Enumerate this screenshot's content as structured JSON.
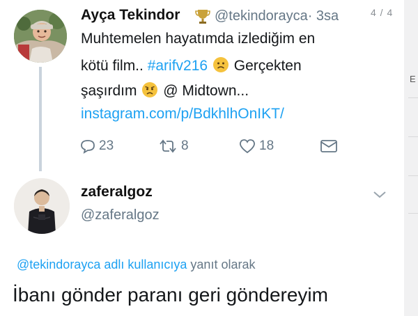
{
  "page_counter": "4 / 4",
  "tweet": {
    "author_name": "Ayça Tekindor",
    "author_handle": "@tekindorayca",
    "time": "· 3sa",
    "line1": "Muhtemelen hayatımda izlediğim en",
    "line2_text": "kötü film..",
    "hashtag": "#arifv216",
    "line2_after": "Gerçekten",
    "line3_before": "şaşırdım",
    "line3_after": "@ Midtown...",
    "link": "instagram.com/p/BdkhlhOnIKT/",
    "replies": "23",
    "retweets": "8",
    "likes": "18"
  },
  "reply": {
    "author_name": "zaferalgoz",
    "author_handle": "@zaferalgoz",
    "context_mention": "@tekindorayca adlı kullanıcıya",
    "context_suffix": "yanıt olarak",
    "text": "İbanı gönder paranı geri göndereyim"
  },
  "side_panel": {
    "letter": "E"
  },
  "colors": {
    "link_blue": "#1da1f2",
    "muted_gray": "#657786",
    "thread_line": "#c9d3dc"
  },
  "icons": [
    "trophy-icon",
    "sad-face-emoji",
    "anxious-face-emoji",
    "reply-icon",
    "retweet-icon",
    "like-icon",
    "direct-message-icon",
    "chevron-down-icon"
  ]
}
